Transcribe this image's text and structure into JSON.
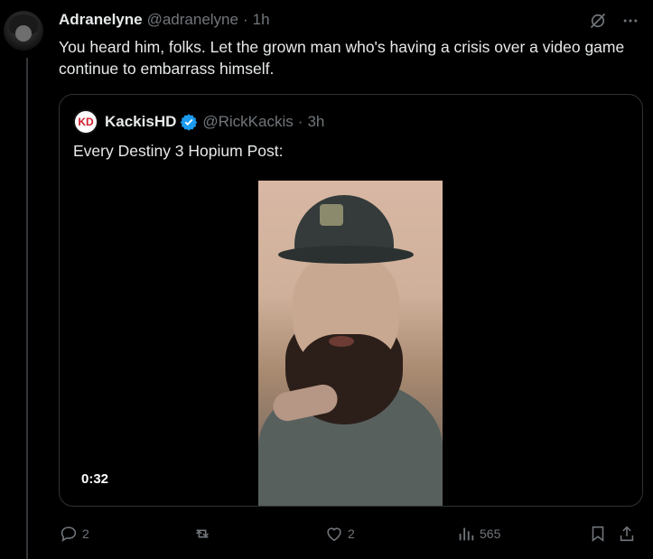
{
  "post": {
    "display_name": "Adranelyne",
    "handle": "@adranelyne",
    "separator": "·",
    "time": "1h",
    "text": "You heard him, folks. Let the grown man who's having a crisis over a video game continue to embarrass himself."
  },
  "quote": {
    "avatar_text": "KD",
    "display_name": "KackisHD",
    "handle": "@RickKackis",
    "separator": "·",
    "time": "3h",
    "text": "Every Destiny 3 Hopium Post:",
    "video_duration": "0:32"
  },
  "actions": {
    "replies": "2",
    "reposts": "",
    "likes": "2",
    "views": "565"
  },
  "icons": {
    "grok": "grok-icon",
    "more": "more-icon",
    "verified": "verified-icon",
    "reply": "reply-icon",
    "repost": "repost-icon",
    "like": "like-icon",
    "views": "views-icon",
    "bookmark": "bookmark-icon",
    "share": "share-icon"
  },
  "colors": {
    "background": "#000000",
    "text": "#e7e9ea",
    "muted": "#71767b",
    "verified": "#1d9bf0",
    "border": "#2f3336"
  }
}
